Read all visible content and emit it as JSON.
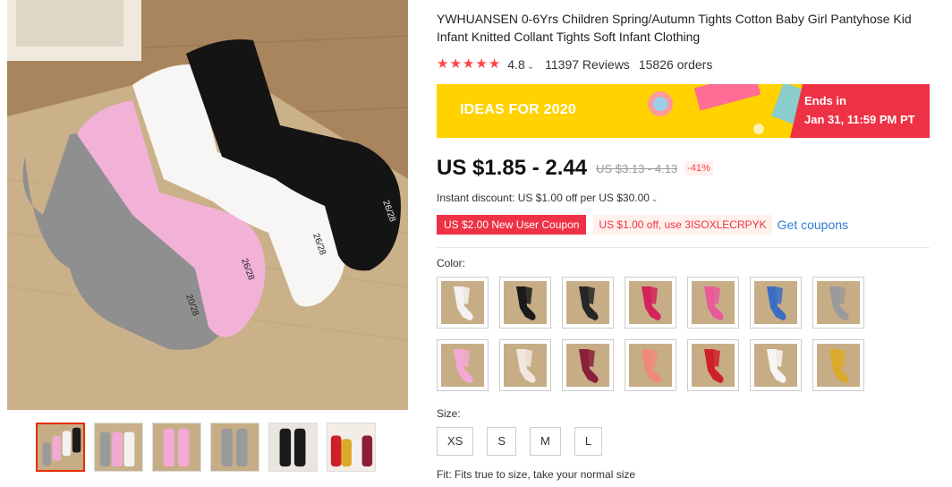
{
  "product": {
    "title": "YWHUANSEN 0-6Yrs Children Spring/Autumn Tights Cotton Baby Girl Pantyhose Kid Infant Knitted Collant Tights Soft Infant Clothing",
    "rating": "4.8",
    "reviews": "11397 Reviews",
    "orders": "15826 orders",
    "stars_filled": 5
  },
  "banner": {
    "ideas": "IDEAS FOR 2020",
    "ends_label": "Ends in",
    "ends_date": "Jan 31, 11:59 PM PT"
  },
  "price": {
    "current": "US $1.85 - 2.44",
    "original": "US $3.13 - 4.13",
    "discount": "-41%"
  },
  "instant_discount": "Instant discount: US $1.00 off per US $30.00",
  "coupons": {
    "new_user": "US $2.00 New User Coupon",
    "code_offer": "US $1.00 off, use 3ISOXLECRPYK",
    "get_coupons": "Get coupons"
  },
  "color": {
    "label": "Color:",
    "swatches": [
      {
        "name": "white",
        "hex": "#f4f2f0"
      },
      {
        "name": "black",
        "hex": "#1a1a1a"
      },
      {
        "name": "black-knit",
        "hex": "#262626"
      },
      {
        "name": "rose-print",
        "hex": "#d4225a"
      },
      {
        "name": "rainbow-stripe",
        "hex": "#e85a9a"
      },
      {
        "name": "multi-dots",
        "hex": "#3a6ec4"
      },
      {
        "name": "grey",
        "hex": "#9a9a9a"
      },
      {
        "name": "pink",
        "hex": "#f2a9d4"
      },
      {
        "name": "cream",
        "hex": "#f1e7df"
      },
      {
        "name": "wine",
        "hex": "#8a1f3a"
      },
      {
        "name": "coral",
        "hex": "#ee8a7a"
      },
      {
        "name": "red",
        "hex": "#cf1f2a"
      },
      {
        "name": "ivory",
        "hex": "#f7f5f2"
      },
      {
        "name": "mustard",
        "hex": "#dcaa2a"
      }
    ]
  },
  "size": {
    "label": "Size:",
    "options": [
      "XS",
      "S",
      "M",
      "L"
    ]
  },
  "fit": "Fit: Fits true to size, take your normal size",
  "thumbnails": [
    {
      "name": "thumb-1",
      "colors": [
        "#1a1a1a",
        "#f4f2f0",
        "#f2a9d4",
        "#9a9a9a"
      ]
    },
    {
      "name": "thumb-2",
      "colors": [
        "#9a9a9a",
        "#f2a9d4",
        "#f4f2f0",
        "#e8e8e8"
      ]
    },
    {
      "name": "thumb-3",
      "colors": [
        "#f2a9d4",
        "#f2a9d4"
      ]
    },
    {
      "name": "thumb-4",
      "colors": [
        "#9a9a9a",
        "#9a9a9a"
      ]
    },
    {
      "name": "thumb-5",
      "colors": [
        "#1a1a1a",
        "#1a1a1a"
      ]
    },
    {
      "name": "thumb-6",
      "colors": [
        "#cf1f2a",
        "#dcaa2a",
        "#f4f2f0",
        "#8a1f3a"
      ]
    }
  ]
}
